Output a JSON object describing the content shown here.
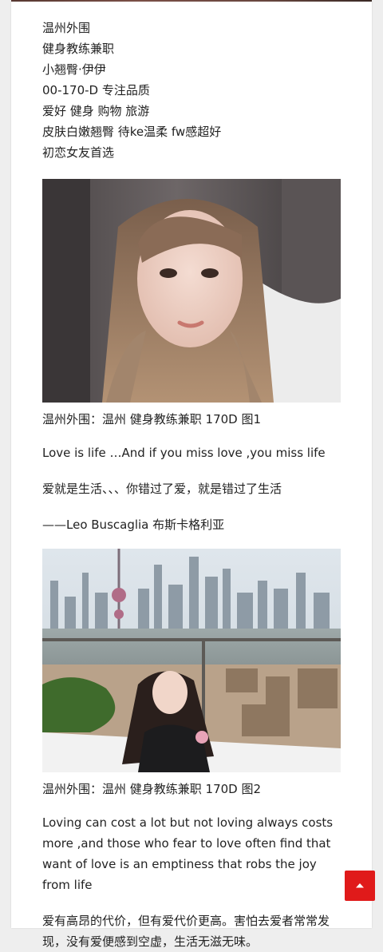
{
  "intro": {
    "lines": [
      "温州外围",
      "健身教练兼职",
      "小翘臀·伊伊",
      "00-170-D 专注品质",
      "爱好 健身 购物 旅游",
      "皮肤白嫩翘臀 待ke温柔 fw感超好",
      "初恋女友首选"
    ]
  },
  "photo1": {
    "caption": "温州外围：温州 健身教练兼职 170D 图1"
  },
  "quote": {
    "english": "Love is life …And if you miss love ,you miss life",
    "chinese": "爱就是生活、、、你错过了爱，就是错过了生活",
    "author": "——Leo Buscaglia 布斯卡格利亚"
  },
  "photo2": {
    "caption": "温州外围：温州 健身教练兼职 170D 图2"
  },
  "closing": {
    "english": "Loving can cost a lot but not loving always costs more ,and those who fear to love often find that want of love is an emptiness that robs the joy from life",
    "chinese": "爱有高昂的代价，但有爱代价更高。害怕去爱者常常发现，没有爱便感到空虚，生活无滋无味。"
  },
  "colors": {
    "accent": "#e01a1a",
    "background": "#eeeeee",
    "card": "#ffffff"
  },
  "icons": {
    "scroll_top": "chevron-up-icon"
  }
}
